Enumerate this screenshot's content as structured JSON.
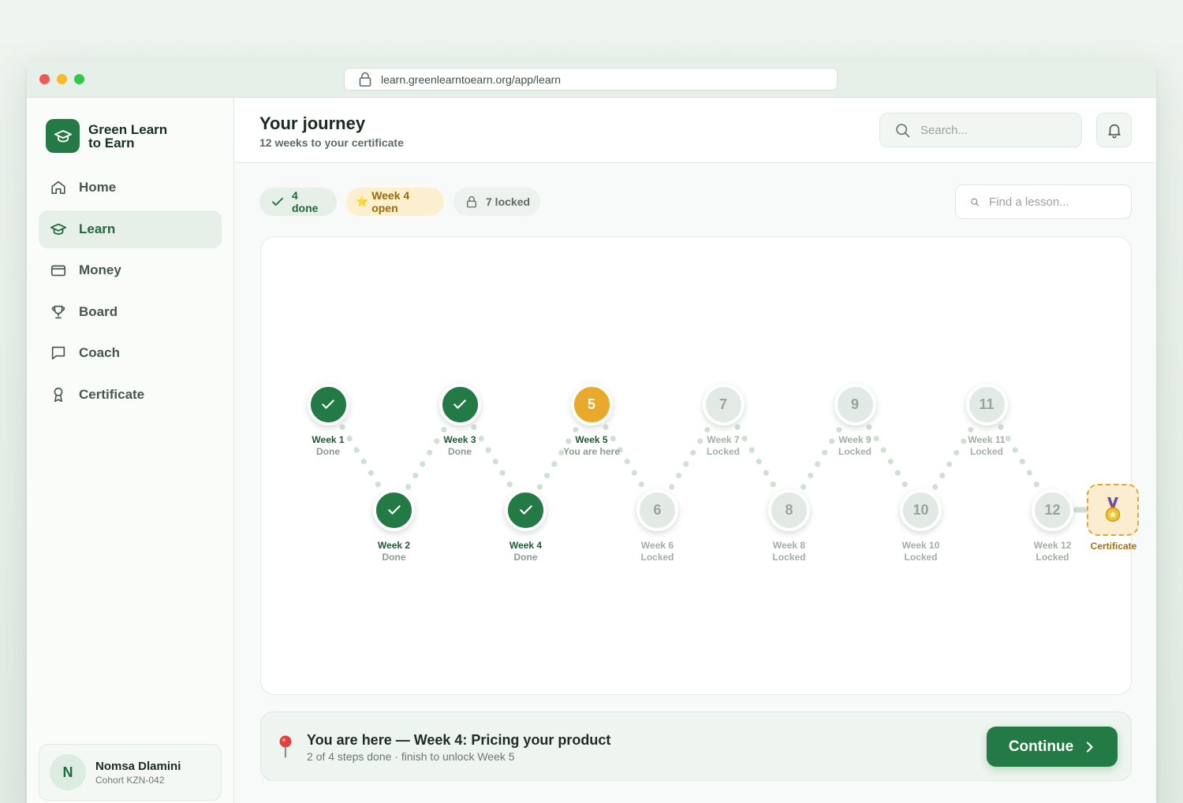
{
  "browser": {
    "url": "learn.greenlearntoearn.org/app/learn"
  },
  "brand": {
    "name": "Green Learn to Earn"
  },
  "nav": {
    "items": [
      {
        "label": "Home",
        "icon": "home-icon",
        "active": false
      },
      {
        "label": "Learn",
        "icon": "graduation-cap-icon",
        "active": true
      },
      {
        "label": "Money",
        "icon": "wallet-icon",
        "active": false
      },
      {
        "label": "Board",
        "icon": "trophy-icon",
        "active": false
      },
      {
        "label": "Coach",
        "icon": "chat-icon",
        "active": false
      },
      {
        "label": "Certificate",
        "icon": "award-icon",
        "active": false
      }
    ]
  },
  "user": {
    "initial": "N",
    "name": "Nomsa Dlamini",
    "cohort": "Cohort KZN-042"
  },
  "header": {
    "title": "Your journey",
    "subtitle": "12 weeks to your certificate",
    "search_placeholder": "Search..."
  },
  "filters": {
    "done": "4 done",
    "open": "Week 4 open",
    "locked": "7 locked",
    "find_placeholder": "Find a lesson..."
  },
  "weeks": [
    {
      "label": "Week 1",
      "status": "Done",
      "state": "done",
      "number": "1"
    },
    {
      "label": "Week 2",
      "status": "Done",
      "state": "done",
      "number": "2"
    },
    {
      "label": "Week 3",
      "status": "Done",
      "state": "done",
      "number": "3"
    },
    {
      "label": "Week 4",
      "status": "Done",
      "state": "done",
      "number": "4"
    },
    {
      "label": "Week 5",
      "status": "You are here",
      "state": "current",
      "number": "5"
    },
    {
      "label": "Week 6",
      "status": "Locked",
      "state": "locked",
      "number": "6"
    },
    {
      "label": "Week 7",
      "status": "Locked",
      "state": "locked",
      "number": "7"
    },
    {
      "label": "Week 8",
      "status": "Locked",
      "state": "locked",
      "number": "8"
    },
    {
      "label": "Week 9",
      "status": "Locked",
      "state": "locked",
      "number": "9"
    },
    {
      "label": "Week 10",
      "status": "Locked",
      "state": "locked",
      "number": "10"
    },
    {
      "label": "Week 11",
      "status": "Locked",
      "state": "locked",
      "number": "11"
    },
    {
      "label": "Week 12",
      "status": "Locked",
      "state": "locked",
      "number": "12"
    }
  ],
  "certificate": {
    "label": "Certificate",
    "icon": "medal-icon"
  },
  "status": {
    "title": "You are here — Week 4: Pricing your product",
    "subtitle": "2 of 4 steps done · finish to unlock Week 5",
    "cta": "Continue"
  },
  "colors": {
    "brand_green": "#237a44",
    "current_gold": "#e9a92a",
    "locked_gray": "#e3e9e5",
    "path_dot": "#cfe0d3"
  }
}
